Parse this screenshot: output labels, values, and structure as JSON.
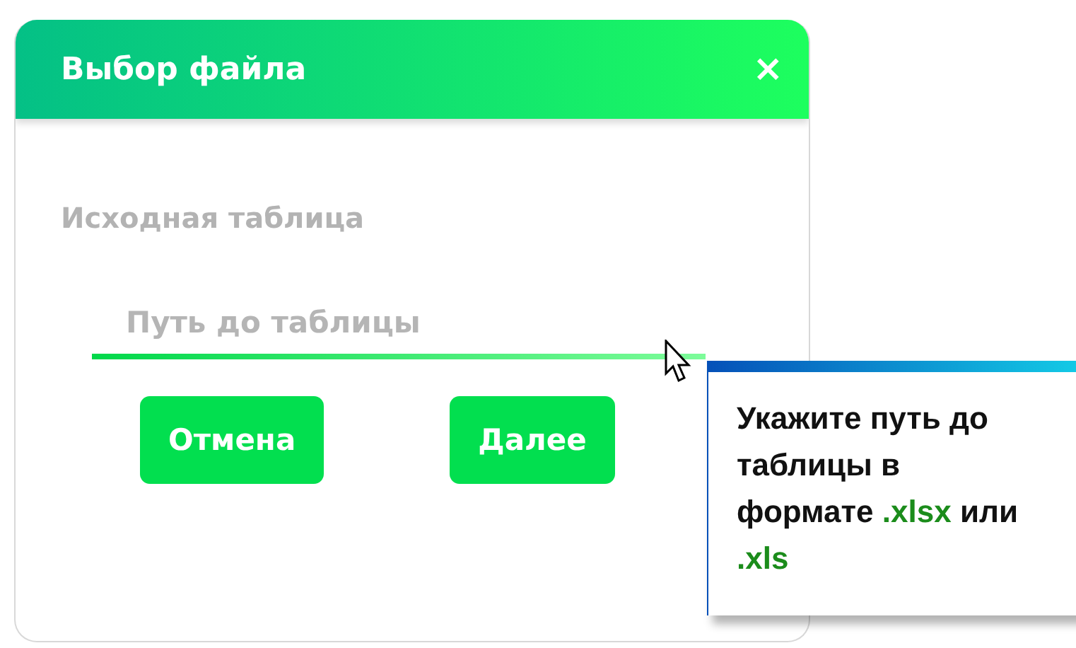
{
  "dialog": {
    "title": "Выбор файла",
    "close": "×",
    "field_label": "Исходная таблица",
    "field": {
      "placeholder": "Путь до таблицы",
      "focused": true
    },
    "buttons": [
      {
        "label": "Отмена"
      },
      {
        "label": "Далее"
      }
    ]
  },
  "tooltip": {
    "parts": [
      {
        "kind": "plain",
        "text": "Укажите путь до таблицы в формате "
      },
      {
        "kind": "ext",
        "text": ".xlsx"
      },
      {
        "kind": "plain",
        "text": " или "
      },
      {
        "kind": "ext",
        "text": ".xls"
      }
    ]
  }
}
